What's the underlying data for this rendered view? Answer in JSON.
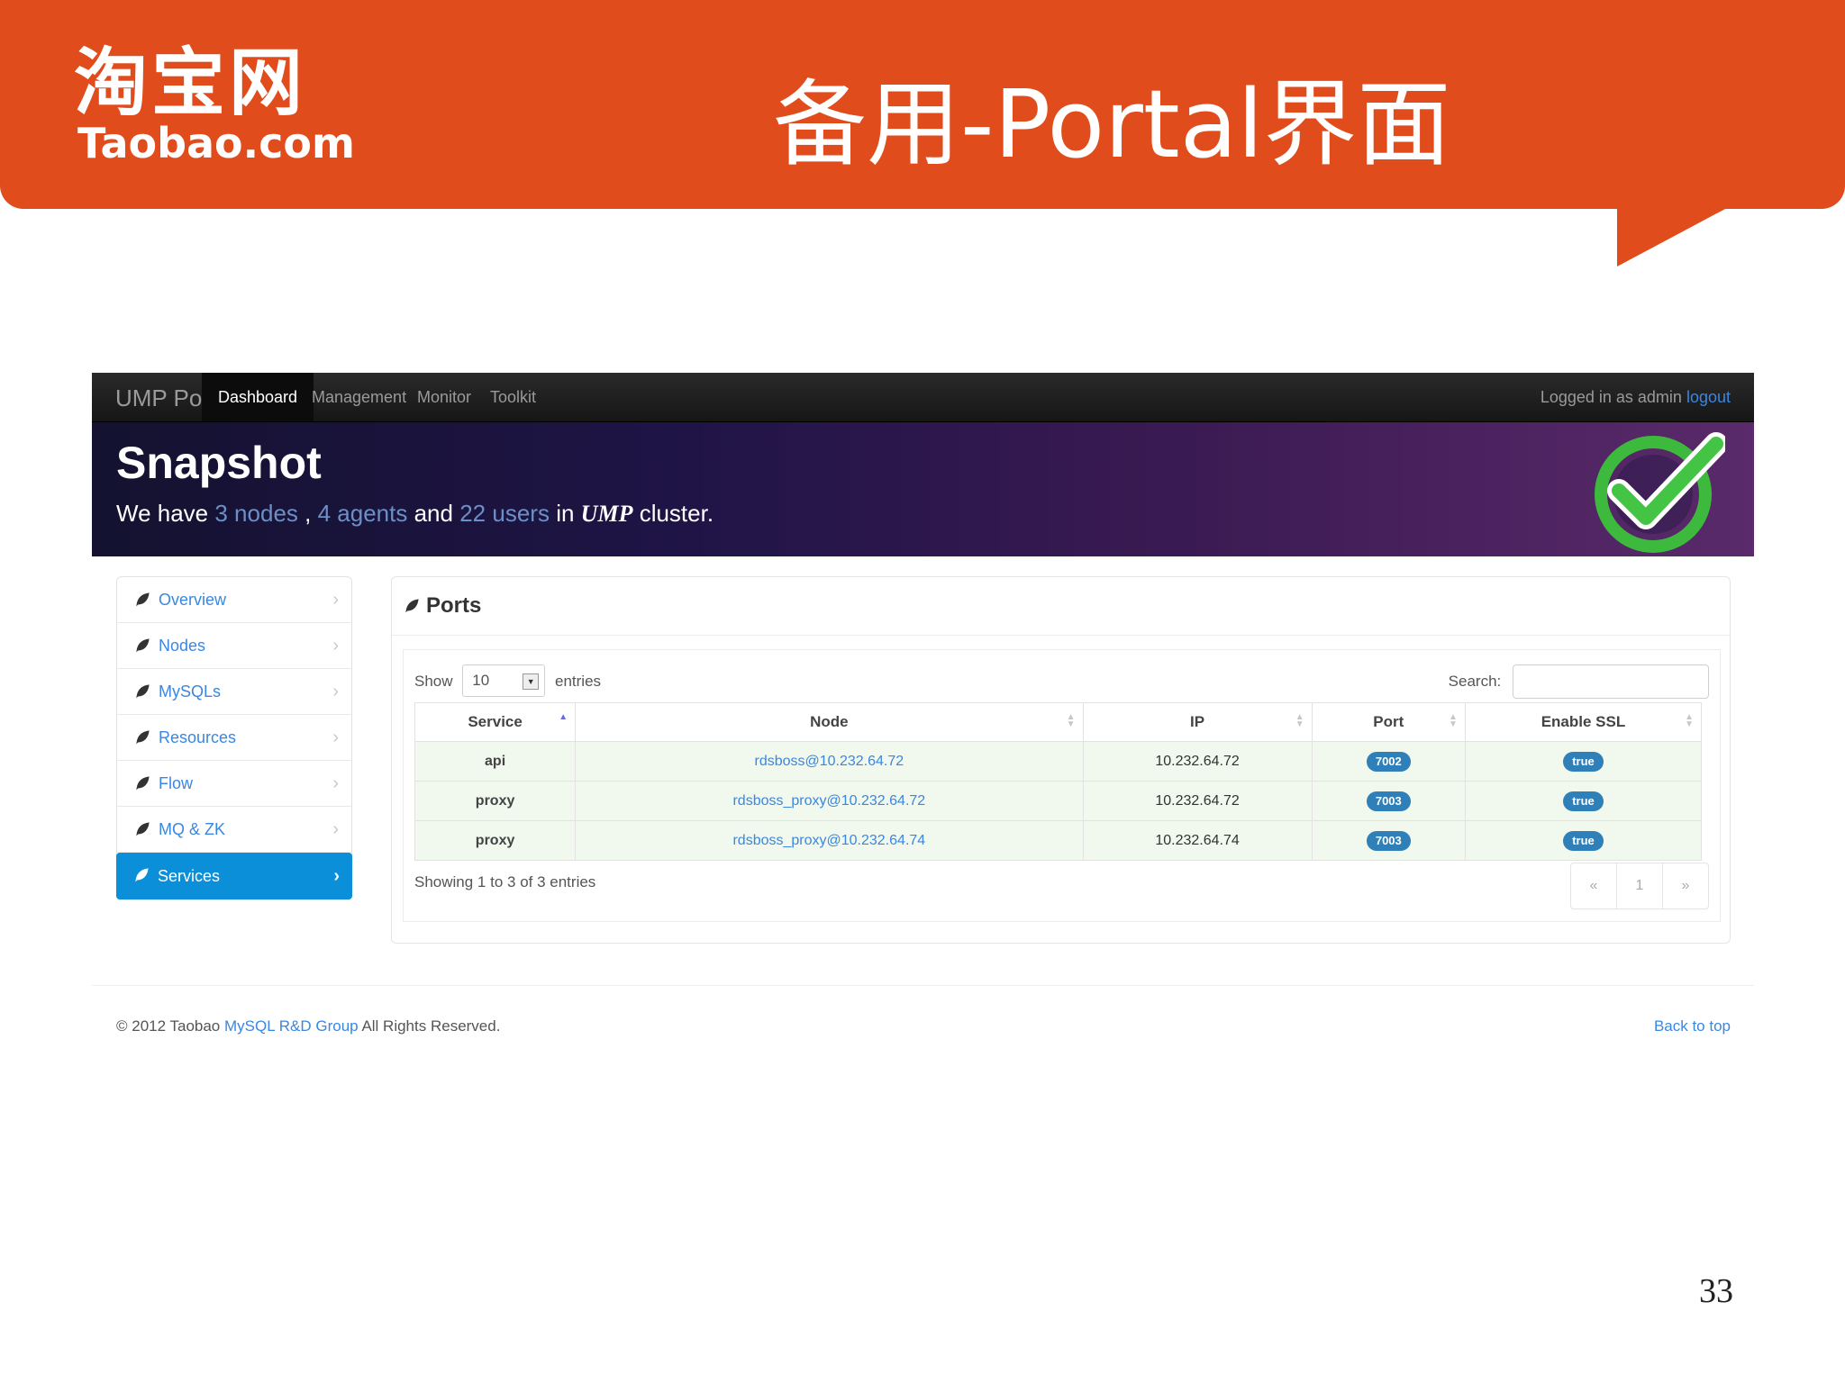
{
  "slide": {
    "logo_cn": "淘宝网",
    "logo_en": "Taobao.com",
    "title": "备用-Portal界面",
    "page_number": "33",
    "banner_color": "#e04c1c"
  },
  "navbar": {
    "brand": "UMP Portal",
    "items": [
      {
        "label": "Dashboard",
        "active": true
      },
      {
        "label": "Management",
        "active": false
      },
      {
        "label": "Monitor",
        "active": false
      },
      {
        "label": "Toolkit",
        "active": false
      }
    ],
    "user_text": "Logged in as admin",
    "logout_label": "logout"
  },
  "hero": {
    "title": "Snapshot",
    "sub_prefix": "We have",
    "nodes": "3 nodes",
    "sep1": ",",
    "agents": "4 agents",
    "and": "and",
    "users": "22 users",
    "in": "in",
    "cluster_name": "UMP",
    "suffix": "cluster.",
    "status_icon": "check-circle-icon"
  },
  "side_nav": {
    "items": [
      {
        "label": "Overview",
        "active": false
      },
      {
        "label": "Nodes",
        "active": false
      },
      {
        "label": "MySQLs",
        "active": false
      },
      {
        "label": "Resources",
        "active": false
      },
      {
        "label": "Flow",
        "active": false
      },
      {
        "label": "MQ & ZK",
        "active": false
      },
      {
        "label": "Services",
        "active": true
      }
    ]
  },
  "panel": {
    "title": "Ports",
    "show_label": "Show",
    "entries_value": "10",
    "entries_label": "entries",
    "search_label": "Search:",
    "columns": [
      "Service",
      "Node",
      "IP",
      "Port",
      "Enable SSL"
    ],
    "rows": [
      {
        "service": "api",
        "node": "rdsboss@10.232.64.72",
        "ip": "10.232.64.72",
        "port": "7002",
        "ssl": "true"
      },
      {
        "service": "proxy",
        "node": "rdsboss_proxy@10.232.64.72",
        "ip": "10.232.64.72",
        "port": "7003",
        "ssl": "true"
      },
      {
        "service": "proxy",
        "node": "rdsboss_proxy@10.232.64.74",
        "ip": "10.232.64.74",
        "port": "7003",
        "ssl": "true"
      }
    ],
    "info": "Showing 1 to 3 of 3 entries",
    "pager": {
      "prev": "«",
      "page": "1",
      "next": "»"
    }
  },
  "footer": {
    "copyright": "© 2012 Taobao",
    "group_link": "MySQL R&D Group",
    "rights": "All Rights Reserved.",
    "back_to_top": "Back to top"
  }
}
